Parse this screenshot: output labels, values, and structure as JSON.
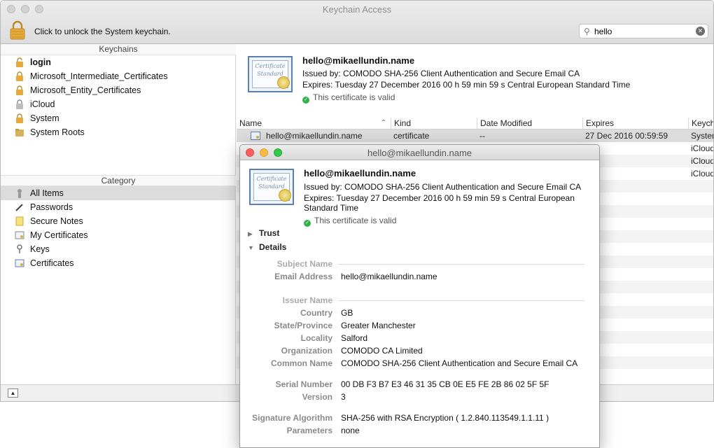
{
  "window": {
    "title": "Keychain Access",
    "unlock_text": "Click to unlock the System keychain."
  },
  "search": {
    "value": "hello",
    "placeholder": "Search"
  },
  "sidebar": {
    "keychains_header": "Keychains",
    "keychains": [
      {
        "label": "login",
        "icon": "unlocked-padlock-icon"
      },
      {
        "label": "Microsoft_Intermediate_Certificates",
        "icon": "padlock-icon"
      },
      {
        "label": "Microsoft_Entity_Certificates",
        "icon": "padlock-icon"
      },
      {
        "label": "iCloud",
        "icon": "padlock-icon"
      },
      {
        "label": "System",
        "icon": "padlock-icon"
      },
      {
        "label": "System Roots",
        "icon": "folder-icon"
      }
    ],
    "category_header": "Category",
    "categories": [
      {
        "label": "All Items",
        "icon": "all-items-icon"
      },
      {
        "label": "Passwords",
        "icon": "pen-icon"
      },
      {
        "label": "Secure Notes",
        "icon": "note-icon"
      },
      {
        "label": "My Certificates",
        "icon": "certificate-icon"
      },
      {
        "label": "Keys",
        "icon": "key-icon"
      },
      {
        "label": "Certificates",
        "icon": "certificate-icon"
      }
    ]
  },
  "detail": {
    "name": "hello@mikaellundin.name",
    "issued_by": "Issued by: COMODO SHA-256 Client Authentication and Secure Email CA",
    "expires": "Expires: Tuesday 27 December 2016 00 h 59 min 59 s Central European Standard Time",
    "valid": "This certificate is valid",
    "cert_text": "Certificate Standard"
  },
  "table": {
    "columns": [
      "Name",
      "Kind",
      "Date Modified",
      "Expires",
      "Keych"
    ],
    "rows": [
      {
        "name": "hello@mikaellundin.name",
        "kind": "certificate",
        "modified": "--",
        "expires": "27 Dec 2016 00:59:59",
        "keychain": "Syster"
      },
      {
        "name": "",
        "kind": "",
        "modified": "",
        "expires": "",
        "keychain": "iCloud"
      },
      {
        "name": "",
        "kind": "",
        "modified": "",
        "expires": "",
        "keychain": "iCloud"
      },
      {
        "name": "",
        "kind": "",
        "modified": "",
        "expires": "",
        "keychain": "iCloud"
      }
    ]
  },
  "info": {
    "title": "hello@mikaellundin.name",
    "name": "hello@mikaellundin.name",
    "issued_by": "Issued by: COMODO SHA-256 Client Authentication and Secure Email CA",
    "expires_1": "Expires: Tuesday 27 December 2016 00 h 59 min 59 s Central European",
    "expires_2": "Standard Time",
    "valid": "This certificate is valid",
    "trust": "Trust",
    "details": "Details",
    "subject_name": "Subject Name",
    "email_label": "Email Address",
    "email_value": "hello@mikaellundin.name",
    "issuer_name": "Issuer Name",
    "fields": [
      {
        "k": "Country",
        "v": "GB"
      },
      {
        "k": "State/Province",
        "v": "Greater Manchester"
      },
      {
        "k": "Locality",
        "v": "Salford"
      },
      {
        "k": "Organization",
        "v": "COMODO CA Limited"
      },
      {
        "k": "Common Name",
        "v": "COMODO SHA-256 Client Authentication and Secure Email CA"
      }
    ],
    "serial_label": "Serial Number",
    "serial_value": "00 DB F3 B7 E3 46 31 35 CB 0E E5 FE 2B 86 02 5F 5F",
    "version_label": "Version",
    "version_value": "3",
    "sig_alg_label": "Signature Algorithm",
    "sig_alg_value": "SHA-256 with RSA Encryption ( 1.2.840.113549.1.1.11 )",
    "params_label": "Parameters",
    "params_value": "none"
  }
}
